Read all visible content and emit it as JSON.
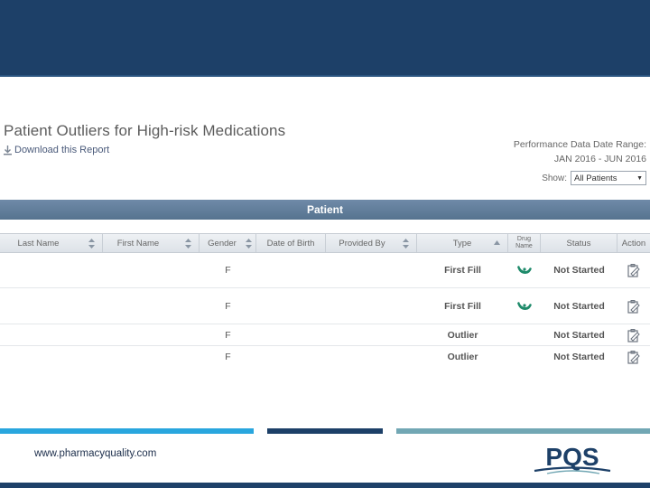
{
  "report": {
    "title": "Patient Outliers for High-risk Medications",
    "download_label": "Download this Report",
    "date_range_label": "Performance Data Date Range:",
    "date_range_value": "JAN 2016 - JUN 2016",
    "show_label": "Show:",
    "show_selected": "All Patients"
  },
  "table": {
    "group_header": "Patient",
    "columns": [
      "Last Name",
      "First Name",
      "Gender",
      "Date of Birth",
      "Provided By",
      "Type",
      "Drug Name",
      "Status",
      "Action"
    ],
    "drug_header_lines": [
      "Drug",
      "Name"
    ],
    "rows": [
      {
        "gender": "F",
        "type": "First Fill",
        "status": "Not Started",
        "drug_icon": "pill-icon"
      },
      {
        "gender": "F",
        "type": "First Fill",
        "status": "Not Started",
        "drug_icon": "pill-icon"
      },
      {
        "gender": "F",
        "type": "Outlier",
        "status": "Not Started",
        "drug_icon": ""
      },
      {
        "gender": "F",
        "type": "Outlier",
        "status": "Not Started",
        "drug_icon": ""
      }
    ]
  },
  "footer": {
    "url": "www.pharmacyquality.com",
    "logo_text": "PQS"
  },
  "colors": {
    "banner": "#1d4068",
    "header_bar": "#5f7b98",
    "stripe_blue": "#29a6de",
    "stripe_navy": "#1d4068",
    "stripe_teal": "#72a7b4",
    "pill_green": "#1e8a6a"
  }
}
